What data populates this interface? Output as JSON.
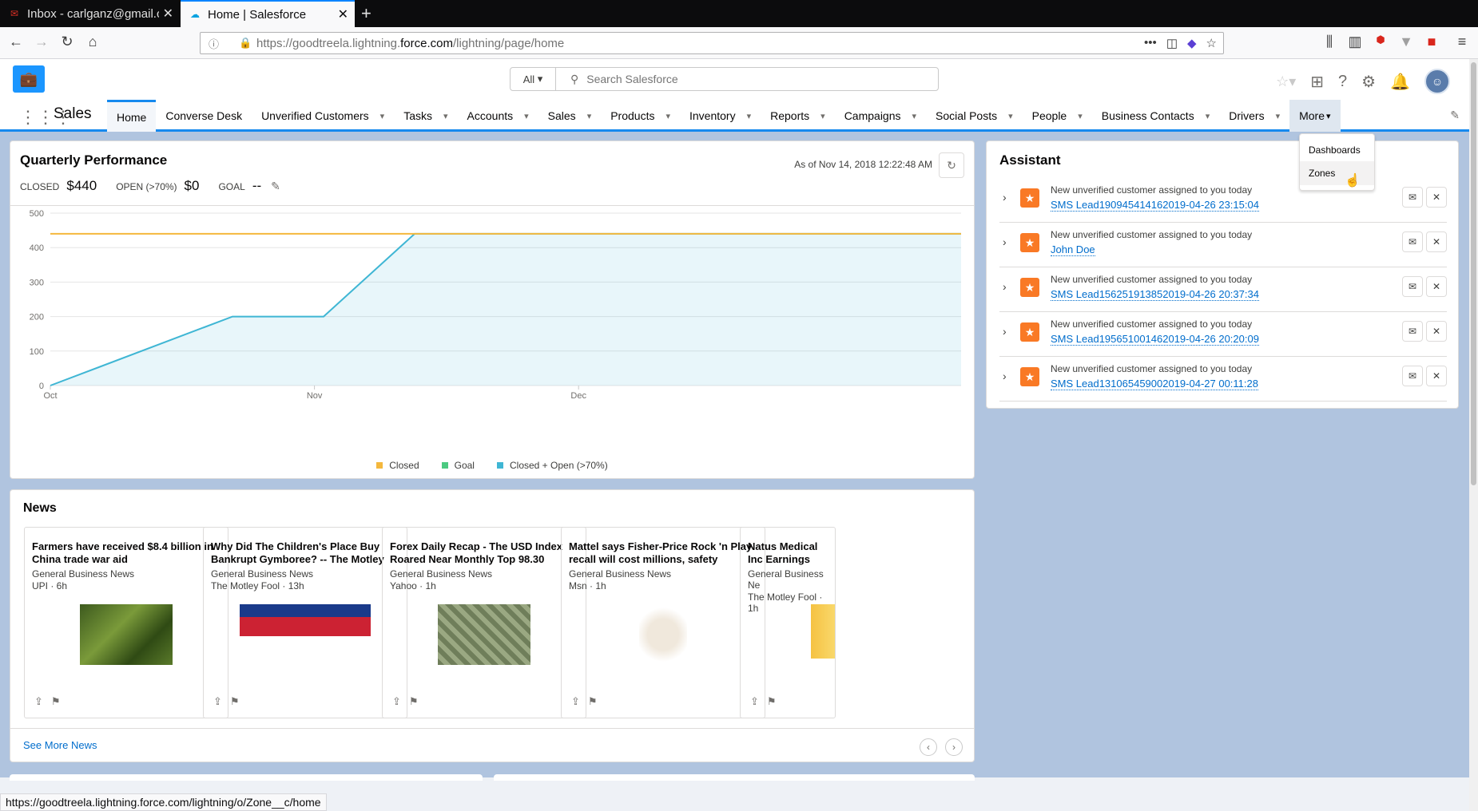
{
  "browser": {
    "tabs": [
      {
        "label": "Inbox - carlganz@gmail.c",
        "active": false
      },
      {
        "label": "Home | Salesforce",
        "active": true
      }
    ],
    "url_prefix": "https://goodtreela.lightning.",
    "url_domain": "force.com",
    "url_suffix": "/lightning/page/home",
    "status_url": "https://goodtreela.lightning.force.com/lightning/o/Zone__c/home"
  },
  "header": {
    "search_scope": "All",
    "search_placeholder": "Search Salesforce"
  },
  "appnav": {
    "app_name": "Sales",
    "items": [
      {
        "label": "Home",
        "active": true,
        "chevron": false
      },
      {
        "label": "Converse Desk",
        "chevron": false
      },
      {
        "label": "Unverified Customers",
        "chevron": true
      },
      {
        "label": "Tasks",
        "chevron": true
      },
      {
        "label": "Accounts",
        "chevron": true
      },
      {
        "label": "Sales",
        "chevron": true
      },
      {
        "label": "Products",
        "chevron": true
      },
      {
        "label": "Inventory",
        "chevron": true
      },
      {
        "label": "Reports",
        "chevron": true
      },
      {
        "label": "Campaigns",
        "chevron": true
      },
      {
        "label": "Social Posts",
        "chevron": true
      },
      {
        "label": "People",
        "chevron": true
      },
      {
        "label": "Business Contacts",
        "chevron": true
      },
      {
        "label": "Drivers",
        "chevron": true
      },
      {
        "label": "More",
        "chevron": true,
        "more": true
      }
    ],
    "more_menu": [
      "Dashboards",
      "Zones"
    ]
  },
  "quarterly": {
    "title": "Quarterly Performance",
    "closed_label": "CLOSED",
    "closed_value": "$440",
    "open_label": "OPEN (>70%)",
    "open_value": "$0",
    "goal_label": "GOAL",
    "goal_value": "--",
    "as_of": "As of Nov 14, 2018 12:22:48 AM"
  },
  "chart_data": {
    "type": "area",
    "x_ticks": [
      "Oct",
      "Nov",
      "Dec"
    ],
    "y_ticks": [
      0,
      100,
      200,
      300,
      400,
      500
    ],
    "ylim": [
      0,
      500
    ],
    "series": [
      {
        "name": "Closed",
        "color": "#f4b83d",
        "x": [
          0,
          1
        ],
        "values": [
          440,
          440
        ],
        "style": "line"
      },
      {
        "name": "Goal",
        "color": "#4bca81",
        "x": [],
        "values": [],
        "style": "line"
      },
      {
        "name": "Closed + Open (>70%)",
        "color": "#3fb6d4",
        "x": [
          0,
          0.2,
          0.3,
          0.4,
          1
        ],
        "values": [
          0,
          200,
          200,
          440,
          440
        ],
        "style": "area"
      }
    ],
    "legend_position": "bottom"
  },
  "news": {
    "title": "News",
    "see_more": "See More News",
    "items": [
      {
        "headline": "Farmers have received $8.4 billion in China trade war aid",
        "category": "General Business News",
        "source": "UPI · 6h",
        "image": "soybean-field-image"
      },
      {
        "headline": "Why Did The Children's Place Buy Bankrupt Gymboree? -- The Motley",
        "category": "General Business News",
        "source": "The Motley Fool · 13h",
        "image": "childrens-place-store-image"
      },
      {
        "headline": "Forex Daily Recap - The USD Index Roared Near Monthly Top 98.30",
        "category": "General Business News",
        "source": "Yahoo · 1h",
        "image": "money-stack-image"
      },
      {
        "headline": "Mattel says Fisher-Price Rock 'n Play recall will cost millions, safety",
        "category": "General Business News",
        "source": "Msn · 1h",
        "image": "baby-sleeper-image"
      },
      {
        "headline": "Natus Medical Inc Earnings Call Tran",
        "category": "General Business Ne",
        "source": "The Motley Fool · 1h",
        "image": "yellow-graphic-image"
      }
    ]
  },
  "assistant": {
    "title": "Assistant",
    "items": [
      {
        "text": "New unverified customer assigned to you today",
        "link": "SMS Lead190945414162019-04-26 23:15:04"
      },
      {
        "text": "New unverified customer assigned to you today",
        "link": "John Doe"
      },
      {
        "text": "New unverified customer assigned to you today",
        "link": "SMS Lead156251913852019-04-26 20:37:34"
      },
      {
        "text": "New unverified customer assigned to you today",
        "link": "SMS Lead195651001462019-04-26 20:20:09"
      },
      {
        "text": "New unverified customer assigned to you today",
        "link": "SMS Lead131065459002019-04-27 00:11:28"
      }
    ]
  }
}
